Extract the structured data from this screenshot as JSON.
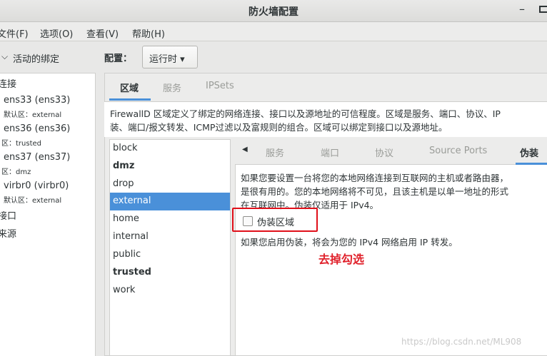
{
  "window": {
    "title": "防火墙配置",
    "minimize": "–"
  },
  "menubar": {
    "file": "文件(F)",
    "options": "选项(O)",
    "view": "查看(V)",
    "help": "帮助(H)"
  },
  "sidebar": {
    "header": "活动的绑定",
    "connections_label": "连接",
    "connections": [
      {
        "name": "ens33 (ens33)",
        "zone": "默认区：external"
      },
      {
        "name": "ens36 (ens36)",
        "zone": "区：trusted"
      },
      {
        "name": "ens37 (ens37)",
        "zone": "区：dmz"
      },
      {
        "name": "virbr0 (virbr0)",
        "zone": "默认区：external"
      }
    ],
    "interfaces_label": "接口",
    "sources_label": "来源"
  },
  "config": {
    "label": "配置：",
    "mode": "运行时 ▾"
  },
  "top_tabs": [
    "区域",
    "服务",
    "IPSets"
  ],
  "description": {
    "line1": "FirewallD 区域定义了绑定的网络连接、接口以及源地址的可信程度。区域是服务、端口、协议、IP",
    "line2": "装、端口/报文转发、ICMP过滤以及富规则的组合。区域可以绑定到接口以及源地址。"
  },
  "zones": [
    "block",
    "dmz",
    "drop",
    "external",
    "home",
    "internal",
    "public",
    "trusted",
    "work"
  ],
  "selected_zone": "external",
  "bold_zones": [
    "dmz",
    "trusted"
  ],
  "sub_tabs": [
    "服务",
    "端口",
    "协议",
    "Source Ports",
    "伪装"
  ],
  "masquerade": {
    "text1": "如果您要设置一台将您的本地网络连接到互联网的主机或者路由器，",
    "text2": "是很有用的。您的本地网络将不可见，且该主机是以单一地址的形式",
    "text3": "在互联网中。伪装仅适用于 IPv4。",
    "checkbox_label": "伪装区域",
    "checked": false,
    "note": "如果您启用伪装，将会为您的 IPv4 网络启用 IP 转发。"
  },
  "annotation": "去掉勾选",
  "watermark": "https://blog.csdn.net/ML908",
  "colors": {
    "accent": "#4a90d9",
    "annotation_red": "#e0101a"
  }
}
